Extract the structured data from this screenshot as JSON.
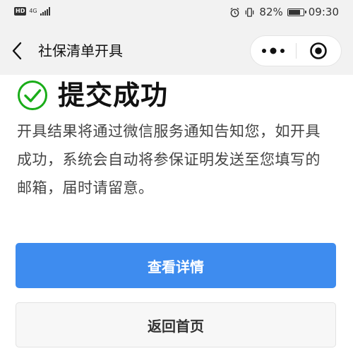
{
  "status_bar": {
    "hd_label": "HD",
    "network_label": "4G",
    "battery_text": "82%",
    "battery_level": 0.82,
    "time": "09:30"
  },
  "nav": {
    "title": "社保清单开具",
    "back_icon": "chevron-left-icon",
    "more_icon": "more-dots-icon",
    "close_icon": "target-close-icon"
  },
  "result": {
    "icon": "check-circle-icon",
    "title": "提交成功",
    "description": "开具结果将通过微信服务通知告知您，如开具成功，系统会自动将参保证明发送至您填写的邮箱，届时请留意。"
  },
  "actions": {
    "primary_label": "查看详情",
    "secondary_label": "返回首页"
  },
  "colors": {
    "primary": "#3e8cef",
    "success": "#1aad19",
    "navbar_bg": "#f2f2f2"
  }
}
